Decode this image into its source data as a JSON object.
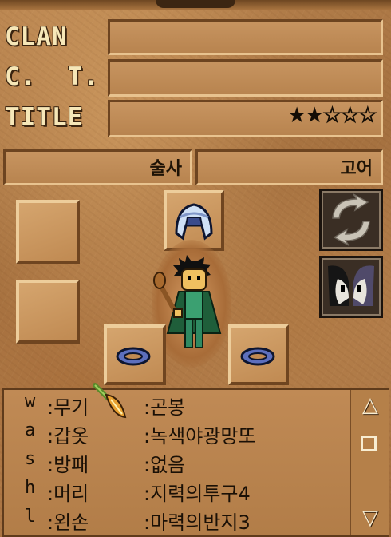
{
  "profile": {
    "clan_label": "CLAN",
    "clan_value": "",
    "ct_label": "C.  T.",
    "ct_value": "",
    "title_label": "TITLE",
    "title_value": "",
    "rank": {
      "filled": 2,
      "total": 5,
      "filled_glyphs": "★★",
      "empty_glyphs": "☆☆☆"
    },
    "class": "술사",
    "race": "고어"
  },
  "equipment_view": {
    "slots": [
      "helmet",
      "left-ring",
      "right-ring",
      "empty-top-left",
      "empty-mid-left"
    ],
    "buttons": [
      "swap-equipment",
      "toggle-view"
    ]
  },
  "equipment_list": {
    "rows": [
      {
        "key": "w",
        "slot": ":무기",
        "item": ":곤봉"
      },
      {
        "key": "a",
        "slot": ":갑옷",
        "item": ":녹색야광망또"
      },
      {
        "key": "s",
        "slot": ":방패",
        "item": ":없음"
      },
      {
        "key": "h",
        "slot": ":머리",
        "item": ":지력의투구4"
      },
      {
        "key": "l",
        "slot": ":왼손",
        "item": ":마력의반지3"
      }
    ],
    "scroll_up": "△",
    "scroll_down": "▽"
  },
  "colors": {
    "label": "#f6e7b8",
    "panel": "#b8844f",
    "text": "#1a1006"
  }
}
